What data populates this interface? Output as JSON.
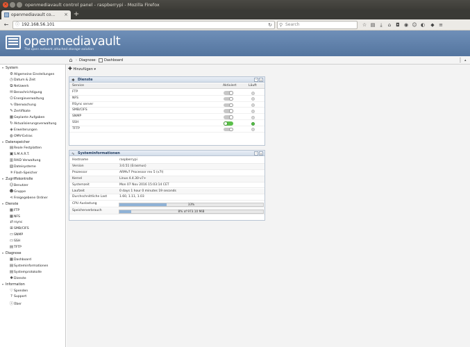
{
  "window": {
    "title": "openmediavault control panel - raspberrypi - Mozilla Firefox"
  },
  "browser": {
    "tab_title": "openmediavault co...",
    "url": "192.168.56.101",
    "search_placeholder": "Search"
  },
  "header": {
    "logo_text": "openmediavault",
    "tagline": "The open network attached storage solution"
  },
  "breadcrumb": [
    "Diagnose",
    "Dashboard"
  ],
  "toolbar": {
    "add_label": "Hinzufügen"
  },
  "sidebar": [
    {
      "label": "System",
      "items": [
        {
          "label": "Allgemeine Einstellungen",
          "icon": "gear-icon",
          "glyph": "⚙"
        },
        {
          "label": "Datum & Zeit",
          "icon": "clock-icon",
          "glyph": "◷"
        },
        {
          "label": "Netzwerk",
          "icon": "network-icon",
          "glyph": "⧉"
        },
        {
          "label": "Benachrichtigung",
          "icon": "mail-icon",
          "glyph": "✉"
        },
        {
          "label": "Energieverwaltung",
          "icon": "power-icon",
          "glyph": "⏻"
        },
        {
          "label": "Überwachung",
          "icon": "monitoring-icon",
          "glyph": "∿"
        },
        {
          "label": "Zertifikate",
          "icon": "certificate-icon",
          "glyph": "✎"
        },
        {
          "label": "Geplante Aufgaben",
          "icon": "calendar-icon",
          "glyph": "▦"
        },
        {
          "label": "Aktualisierungsverwaltung",
          "icon": "update-icon",
          "glyph": "↻"
        },
        {
          "label": "Erweiterungen",
          "icon": "plugin-icon",
          "glyph": "◈"
        },
        {
          "label": "OMV-Extras",
          "icon": "extras-icon",
          "glyph": "◍"
        }
      ]
    },
    {
      "label": "Datenspeicher",
      "items": [
        {
          "label": "Reale Festplatten",
          "icon": "disk-icon",
          "glyph": "▤"
        },
        {
          "label": "S.M.A.R.T.",
          "icon": "smart-icon",
          "glyph": "▣"
        },
        {
          "label": "RAID Verwaltung",
          "icon": "raid-icon",
          "glyph": "▥"
        },
        {
          "label": "Dateisysteme",
          "icon": "filesystem-icon",
          "glyph": "▧"
        },
        {
          "label": "Flash-Speicher",
          "icon": "flash-icon",
          "glyph": "✳"
        }
      ]
    },
    {
      "label": "Zugriffskontrolle",
      "items": [
        {
          "label": "Benutzer",
          "icon": "user-icon",
          "glyph": "☺"
        },
        {
          "label": "Gruppe",
          "icon": "group-icon",
          "glyph": "☻"
        },
        {
          "label": "Freigegebene Ordner",
          "icon": "share-icon",
          "glyph": "⋖"
        }
      ]
    },
    {
      "label": "Dienste",
      "items": [
        {
          "label": "FTP",
          "icon": "ftp-icon",
          "glyph": "▦"
        },
        {
          "label": "NFS",
          "icon": "nfs-icon",
          "glyph": "▦"
        },
        {
          "label": "rsync",
          "icon": "rsync-icon",
          "glyph": "⇄"
        },
        {
          "label": "SMB/CIFS",
          "icon": "smb-icon",
          "glyph": "⊞"
        },
        {
          "label": "SNMP",
          "icon": "snmp-icon",
          "glyph": "▭"
        },
        {
          "label": "SSH",
          "icon": "ssh-icon",
          "glyph": "▭"
        },
        {
          "label": "TFTP",
          "icon": "tftp-icon",
          "glyph": "▤"
        }
      ]
    },
    {
      "label": "Diagnose",
      "items": [
        {
          "label": "Dashboard",
          "icon": "dashboard-icon",
          "glyph": "▦"
        },
        {
          "label": "Systeminformationen",
          "icon": "info-icon",
          "glyph": "▤"
        },
        {
          "label": "Systemprotokolle",
          "icon": "log-icon",
          "glyph": "▤"
        },
        {
          "label": "Dienste",
          "icon": "services-icon",
          "glyph": "✱"
        }
      ]
    },
    {
      "label": "Information",
      "items": [
        {
          "label": "Spenden",
          "icon": "donate-icon",
          "glyph": "♡"
        },
        {
          "label": "Support",
          "icon": "support-icon",
          "glyph": "?"
        },
        {
          "label": "Über",
          "icon": "about-icon",
          "glyph": "ⓘ"
        }
      ]
    }
  ],
  "services_panel": {
    "title": "Dienste",
    "columns": [
      "Service",
      "Aktiviert",
      "Läuft"
    ],
    "rows": [
      {
        "name": "FTP",
        "enabled": false,
        "running": false
      },
      {
        "name": "NFS",
        "enabled": false,
        "running": false
      },
      {
        "name": "RSync server",
        "enabled": false,
        "running": false
      },
      {
        "name": "SMB/CIFS",
        "enabled": false,
        "running": false
      },
      {
        "name": "SNMP",
        "enabled": false,
        "running": false
      },
      {
        "name": "SSH",
        "enabled": true,
        "running": true
      },
      {
        "name": "TFTP",
        "enabled": false,
        "running": false
      }
    ]
  },
  "sysinfo_panel": {
    "title": "Systeminformationen",
    "rows": [
      {
        "key": "Hostname",
        "value": "raspberrypi"
      },
      {
        "key": "Version",
        "value": "3.0.51 (Erasmus)"
      },
      {
        "key": "Prozessor",
        "value": "ARMv7 Processor rev 5 (v7l)"
      },
      {
        "key": "Kernel",
        "value": "Linux 4.4.30-v7+"
      },
      {
        "key": "Systemzeit",
        "value": "Mon 07 Nov 2016 15:03:14 CET"
      },
      {
        "key": "Laufzeit",
        "value": "0 days 1 hour 0 minutes 19 seconds"
      },
      {
        "key": "Durchschnittliche Last",
        "value": "1.60, 1.11, 1.03"
      }
    ],
    "cpu": {
      "label": "CPU Auslastung",
      "text": "33%",
      "fraction": 0.33
    },
    "memory": {
      "label": "Speicherverbrauch",
      "text": "8% of 973.10 MiB",
      "fraction": 0.08
    }
  }
}
